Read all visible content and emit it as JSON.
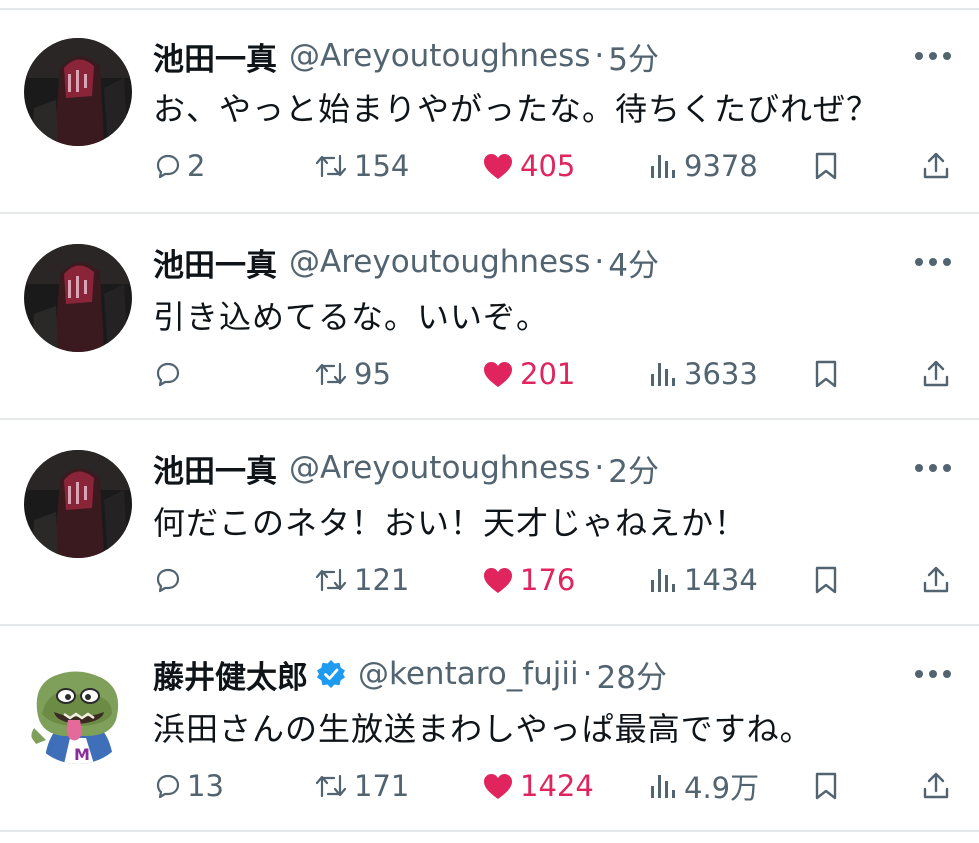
{
  "colors": {
    "like": "#e0245e",
    "muted": "#536471",
    "verified": "#1d9bf0",
    "text": "#0f1419"
  },
  "tweets": [
    {
      "name": "池田一真",
      "handle": "@Areyoutoughness",
      "dot": "·",
      "time": "5分",
      "text": "お、やっと始まりやがったな。待ちくたびれぜ？",
      "replies": "2",
      "retweets": "154",
      "likes": "405",
      "views": "9378",
      "verified": false
    },
    {
      "name": "池田一真",
      "handle": "@Areyoutoughness",
      "dot": "·",
      "time": "4分",
      "text": "引き込めてるな。いいぞ。",
      "replies": "",
      "retweets": "95",
      "likes": "201",
      "views": "3633",
      "verified": false
    },
    {
      "name": "池田一真",
      "handle": "@Areyoutoughness",
      "dot": "·",
      "time": "2分",
      "text": "何だこのネタ！おい！天才じゃねえか！",
      "replies": "",
      "retweets": "121",
      "likes": "176",
      "views": "1434",
      "verified": false
    },
    {
      "name": "藤井健太郎",
      "handle": "@kentaro_fujii",
      "dot": "·",
      "time": "28分",
      "text": "浜田さんの生放送まわしやっぱ最高ですね。",
      "replies": "13",
      "retweets": "171",
      "likes": "1424",
      "views": "4.9万",
      "verified": true
    }
  ]
}
